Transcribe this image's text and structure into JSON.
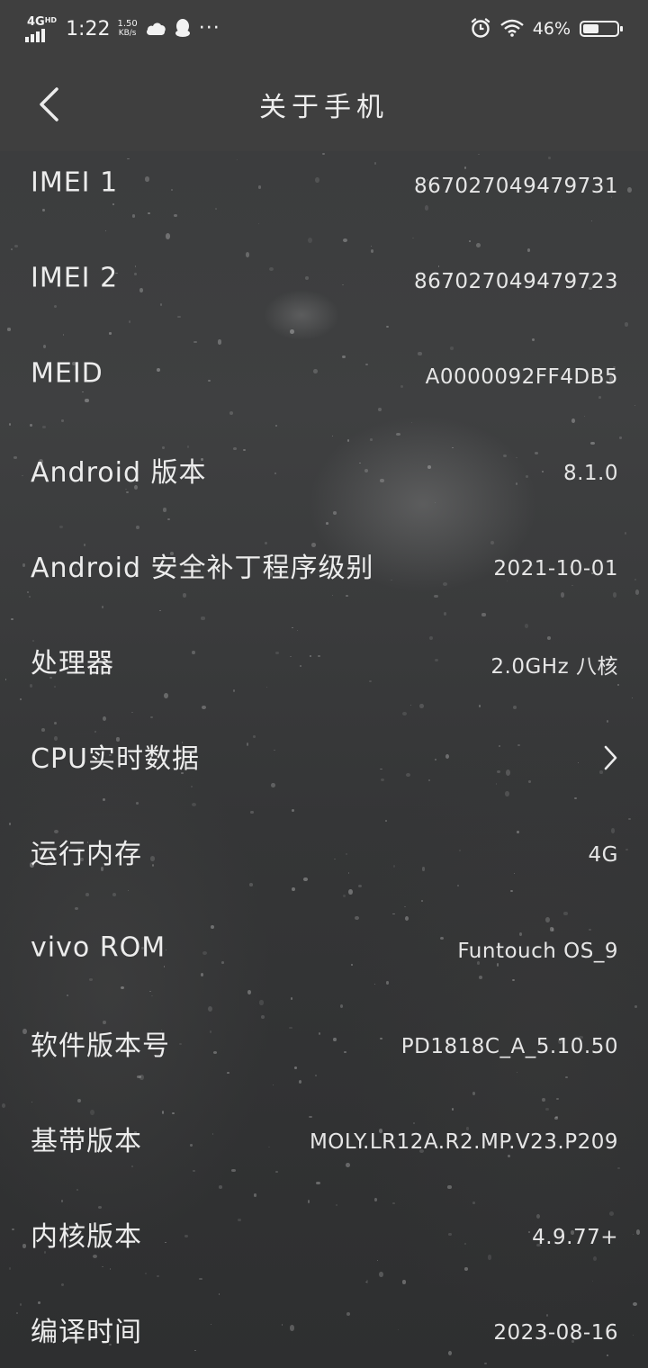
{
  "status_bar": {
    "network": "4G",
    "network_suffix": "HD",
    "time": "1:22",
    "speed_value": "1.50",
    "speed_unit": "KB/s",
    "more": "···",
    "battery_percent": "46%",
    "battery_level": 0.46
  },
  "header": {
    "title": "关于手机"
  },
  "rows": [
    {
      "label": "IMEI 1",
      "value": "867027049479731"
    },
    {
      "label": "IMEI 2",
      "value": "867027049479723"
    },
    {
      "label": "MEID",
      "value": "A0000092FF4DB5"
    },
    {
      "label": "Android 版本",
      "value": "8.1.0"
    },
    {
      "label": "Android 安全补丁程序级别",
      "value": "2021-10-01"
    },
    {
      "label": "处理器",
      "value": "2.0GHz 八核"
    },
    {
      "label": "CPU实时数据",
      "value": ""
    },
    {
      "label": "运行内存",
      "value": "4G"
    },
    {
      "label": "vivo ROM",
      "value": "Funtouch OS_9"
    },
    {
      "label": "软件版本号",
      "value": "PD1818C_A_5.10.50"
    },
    {
      "label": "基带版本",
      "value": "MOLY.LR12A.R2.MP.V23.P209"
    },
    {
      "label": "内核版本",
      "value": "4.9.77+"
    },
    {
      "label": "编译时间",
      "value": "2023-08-16"
    }
  ]
}
